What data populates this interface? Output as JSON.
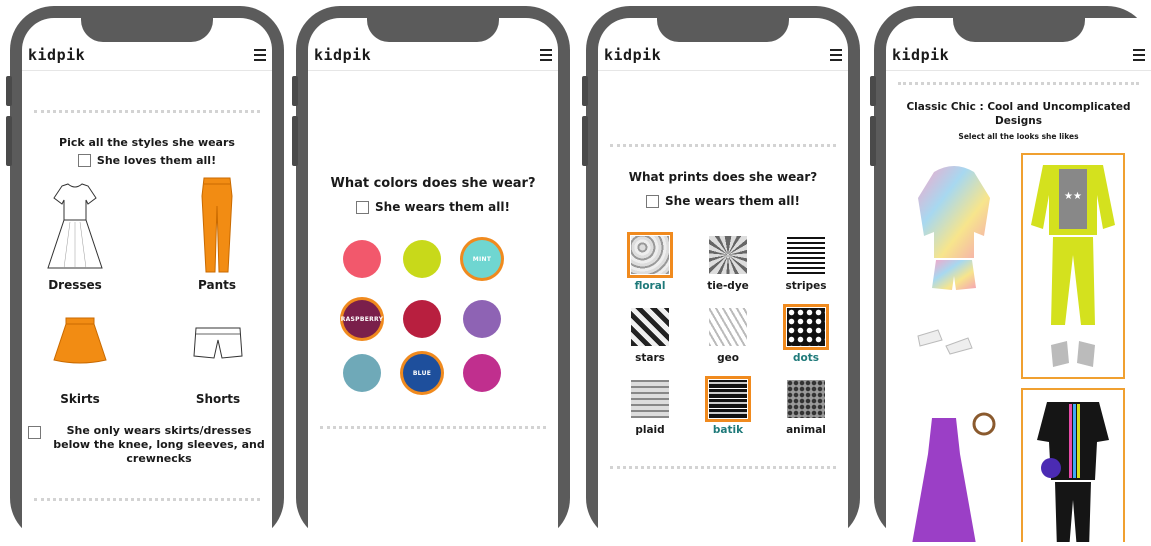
{
  "brand": {
    "logo": "kidpik",
    "accent": "#f08a1e",
    "teal": "#1f7a7a"
  },
  "screen1": {
    "question": "Pick all the styles she wears",
    "love_all": "She loves them all!",
    "items": [
      {
        "label": "Dresses"
      },
      {
        "label": "Pants"
      },
      {
        "label": "Skirts"
      },
      {
        "label": "Shorts"
      }
    ],
    "modest_option": "She only wears skirts/dresses below the knee, long sleeves, and crewnecks"
  },
  "screen2": {
    "question": "What colors does she wear?",
    "wear_all": "She wears them all!",
    "swatches": [
      {
        "color": "#f2586c",
        "label": "",
        "selected": false
      },
      {
        "color": "#c8d91a",
        "label": "",
        "selected": false
      },
      {
        "color": "#6fd6d1",
        "label": "MINT",
        "selected": true
      },
      {
        "color": "#7a1f4b",
        "label": "RASPBERRY",
        "selected": true
      },
      {
        "color": "#b81f3f",
        "label": "",
        "selected": false
      },
      {
        "color": "#8e63b4",
        "label": "",
        "selected": false
      },
      {
        "color": "#6fa9b8",
        "label": "",
        "selected": false
      },
      {
        "color": "#1e4f9c",
        "label": "BLUE",
        "selected": true
      },
      {
        "color": "#c02f8e",
        "label": "",
        "selected": false
      }
    ]
  },
  "screen3": {
    "question": "What prints does she wear?",
    "wear_all": "She wears them all!",
    "prints": [
      {
        "label": "floral",
        "selected": true
      },
      {
        "label": "tie-dye",
        "selected": false
      },
      {
        "label": "stripes",
        "selected": false
      },
      {
        "label": "stars",
        "selected": false
      },
      {
        "label": "geo",
        "selected": false
      },
      {
        "label": "dots",
        "selected": true
      },
      {
        "label": "plaid",
        "selected": false
      },
      {
        "label": "batik",
        "selected": true
      },
      {
        "label": "animal",
        "selected": false
      }
    ]
  },
  "screen4": {
    "title": "Classic Chic : Cool and Uncomplicated Designs",
    "subtitle": "Select all the looks she likes"
  }
}
